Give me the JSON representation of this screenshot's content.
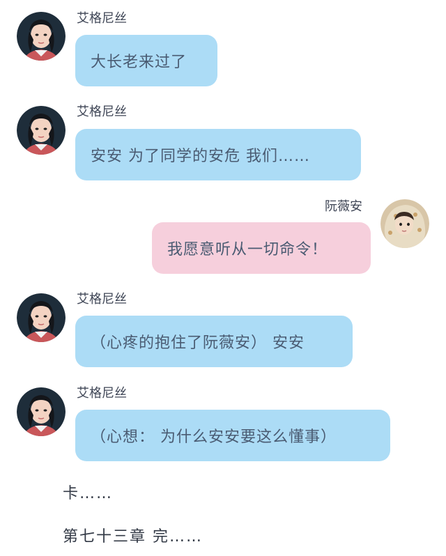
{
  "messages": [
    {
      "sender": "艾格尼丝",
      "text": "大长老来过了"
    },
    {
      "sender": "艾格尼丝",
      "text": "安安 为了同学的安危 我们……"
    },
    {
      "sender": "阮薇安",
      "text": "我愿意听从一切命令！"
    },
    {
      "sender": "艾格尼丝",
      "text": "（心疼的抱住了阮薇安） 安安"
    },
    {
      "sender": "艾格尼丝",
      "text": "（心想： 为什么安安要这么懂事）"
    }
  ],
  "narration": [
    "卡……",
    "第七十三章 完……"
  ],
  "colors": {
    "left_bubble": "#acdcf6",
    "right_bubble": "#f6cfdc"
  }
}
